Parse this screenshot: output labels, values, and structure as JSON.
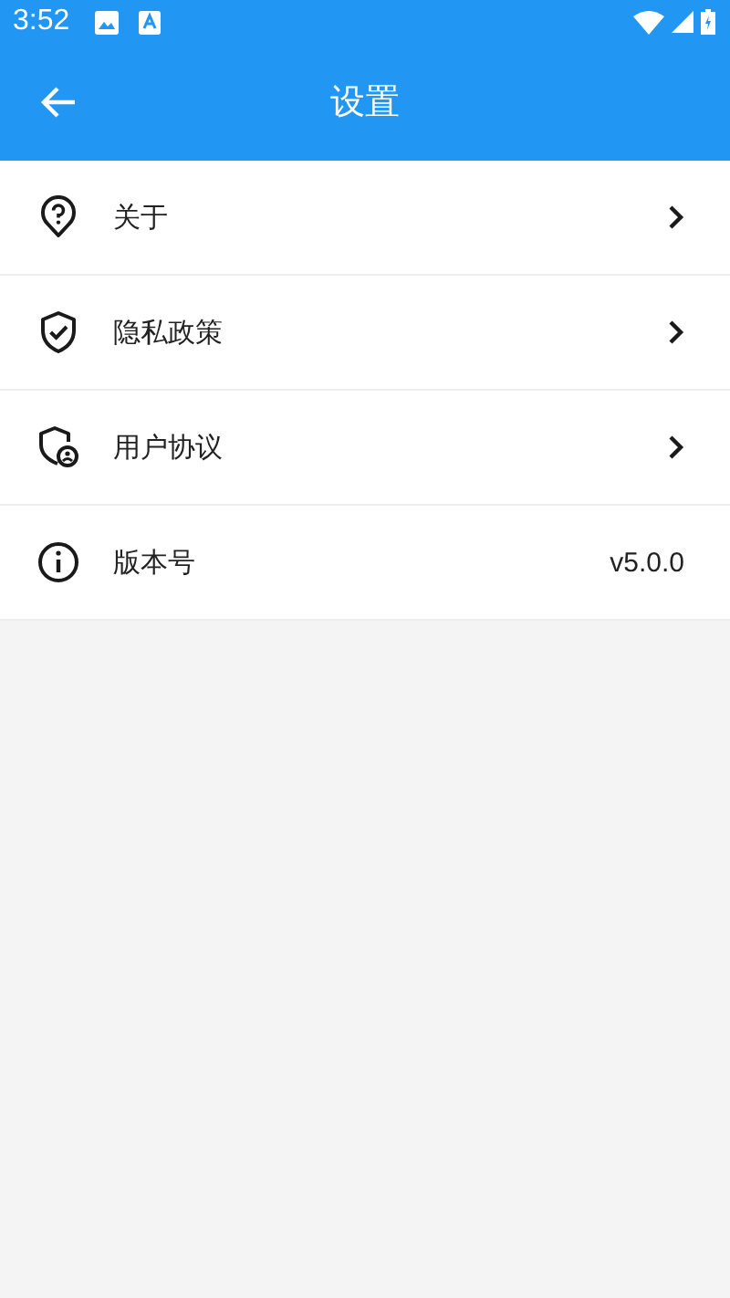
{
  "status_bar": {
    "time": "3:52"
  },
  "toolbar": {
    "title": "设置"
  },
  "settings": [
    {
      "kind": "link",
      "label": "关于"
    },
    {
      "kind": "link",
      "label": "隐私政策"
    },
    {
      "kind": "link",
      "label": "用户协议"
    },
    {
      "kind": "value",
      "label": "版本号",
      "value": "v5.0.0"
    }
  ]
}
